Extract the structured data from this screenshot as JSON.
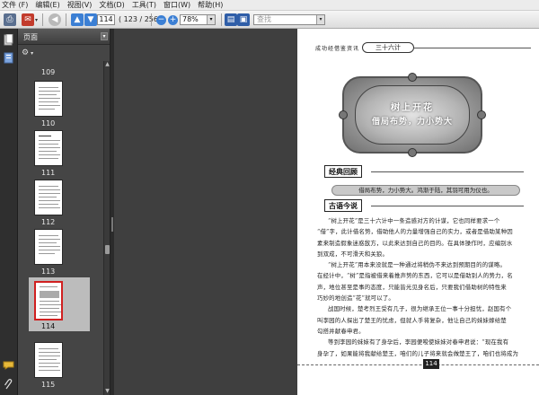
{
  "menubar": {
    "items": [
      "文件 (F)",
      "编辑(E)",
      "视图(V)",
      "文档(D)",
      "工具(T)",
      "窗口(W)",
      "帮助(H)"
    ]
  },
  "toolbar": {
    "page_current": "114",
    "page_count_text": "( 123 / 256 )",
    "zoom_value": "78%",
    "find_placeholder": "查找"
  },
  "panel": {
    "title": "页面"
  },
  "thumbnails": [
    {
      "label": "109",
      "selected": false
    },
    {
      "label": "110",
      "selected": false
    },
    {
      "label": "111",
      "selected": false
    },
    {
      "label": "112",
      "selected": false
    },
    {
      "label": "113",
      "selected": false
    },
    {
      "label": "114",
      "selected": true
    },
    {
      "label": "115",
      "selected": false
    }
  ],
  "document": {
    "header_left": "成功经借鉴资讯",
    "header_right": "三十六计",
    "banner_title": "树上开花",
    "banner_subtitle": "借局布势，力小势大",
    "section1_title": "经典回顾",
    "quote": "借局布势，力小势大。鸿渐于陆，其羽可用为仪也。",
    "section2_title": "古语今说",
    "body": [
      "“树上开花”是三十六计中一条造感对方的计谋，它也同样要求一个",
      "“借”字，此计借名势，借助他人的力量增强自己的实力，或者是借助某种因",
      "素来制造假象迷惑敌方，以此来达到自己的目的。在具体操作时，应编别水",
      "到双成，不可滑天和关狼。",
      "“树上开花”用本来没就是一种通过将稍伪不来达到预期目的的谋略。",
      "在经计中，“树”是指被借来着推声势的东西，它可以是借助别人的势力，名",
      "声，地位甚至是事的态度，只能皆光见身名后，只要我们借助树的特性来",
      "巧妙的地创造“花”就可以了。",
      "战国时候，楚考烈王受有几子，很为继承王位一事十分担忧，赵国有个",
      "叫李园的人探出了楚王的忧虑，但就人手将复杂，他让自己的妹妹嫁给楚",
      "勾搭并献春申君。",
      "等到李园的妹妹有了身孕后，李园便唆使妹妹对春申君说：“现在我有",
      "身孕了，如果能将我献给楚王，咱们的儿子将来就会做楚王了，咱们也将成为"
    ],
    "page_number": "114"
  }
}
